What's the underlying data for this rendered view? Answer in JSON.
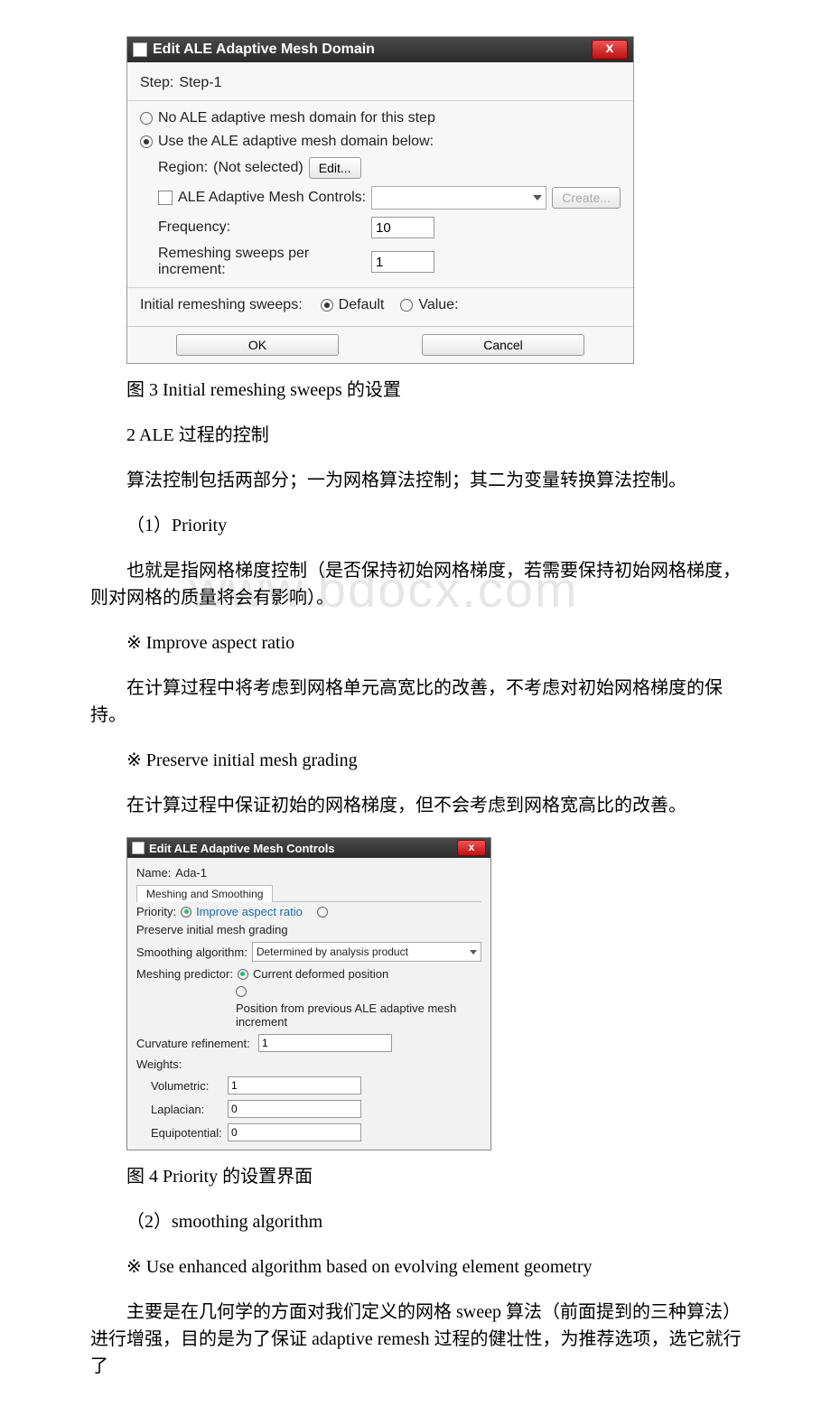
{
  "watermark": "www.bdocx.com",
  "dialog1": {
    "title": "Edit ALE Adaptive Mesh Domain",
    "close": "x",
    "step_prefix": "Step:",
    "step_value": "Step-1",
    "opt_none": "No ALE adaptive mesh domain for this step",
    "opt_use": "Use the ALE adaptive mesh domain below:",
    "region_label": "Region:",
    "region_value": "(Not selected)",
    "edit_btn": "Edit...",
    "controls_label": "ALE Adaptive Mesh Controls:",
    "create_btn": "Create...",
    "freq_label": "Frequency:",
    "freq_value": "10",
    "sweeps_label": "Remeshing sweeps per increment:",
    "sweeps_value": "1",
    "init_label": "Initial remeshing sweeps:",
    "init_default": "Default",
    "init_value_lbl": "Value:",
    "ok": "OK",
    "cancel": "Cancel"
  },
  "text": {
    "fig3": "图 3 Initial remeshing sweeps 的设置",
    "h2": "2 ALE 过程的控制",
    "p1": "算法控制包括两部分；一为网格算法控制；其二为变量转换算法控制。",
    "h_priority": "（1）Priority",
    "p2": "也就是指网格梯度控制（是否保持初始网格梯度，若需要保持初始网格梯度，则对网格的质量将会有影响）。",
    "bullet1": "※ Improve aspect ratio",
    "p3": "在计算过程中将考虑到网格单元高宽比的改善，不考虑对初始网格梯度的保持。",
    "bullet2": "※ Preserve initial mesh grading",
    "p4": "在计算过程中保证初始的网格梯度，但不会考虑到网格宽高比的改善。",
    "fig4": "图 4 Priority 的设置界面",
    "h_smooth": "（2）smoothing algorithm",
    "bullet3": "※ Use enhanced algorithm based on evolving element geometry",
    "p5": "主要是在几何学的方面对我们定义的网格 sweep 算法（前面提到的三种算法）进行增强，目的是为了保证 adaptive remesh 过程的健壮性，为推荐选项，选它就行了"
  },
  "dialog2": {
    "title": "Edit ALE Adaptive Mesh Controls",
    "close": "x",
    "name_label": "Name:",
    "name_value": "Ada-1",
    "tab": "Meshing and Smoothing",
    "priority_label": "Priority:",
    "priority_opt1": "Improve aspect ratio",
    "priority_opt2": "Preserve initial mesh grading",
    "smoothing_label": "Smoothing algorithm:",
    "smoothing_value": "Determined by analysis product",
    "predictor_label": "Meshing predictor:",
    "predictor_opt1": "Current deformed position",
    "predictor_opt2": "Position from previous ALE adaptive mesh increment",
    "curv_label": "Curvature refinement:",
    "curv_value": "1",
    "weights_label": "Weights:",
    "w_vol_label": "Volumetric:",
    "w_vol_value": "1",
    "w_lap_label": "Laplacian:",
    "w_lap_value": "0",
    "w_eq_label": "Equipotential:",
    "w_eq_value": "0"
  }
}
